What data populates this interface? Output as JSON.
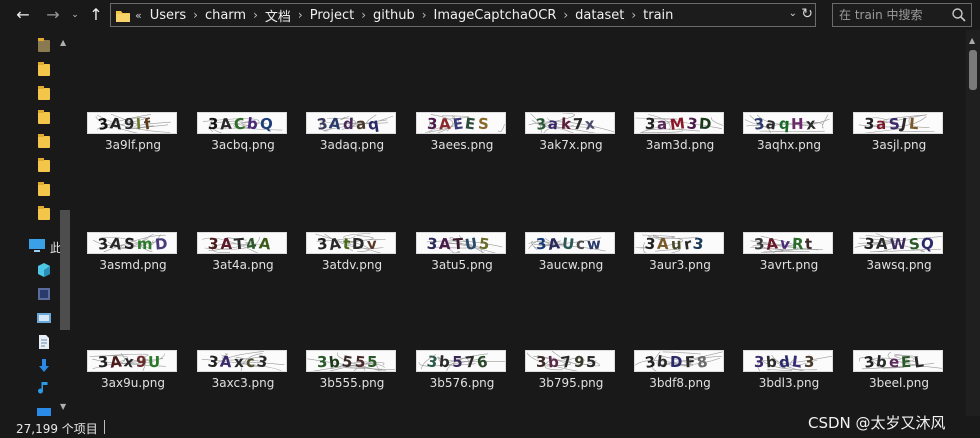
{
  "window": {
    "title": "train"
  },
  "toolbar": {
    "back_icon": "arrow-left-icon",
    "forward_icon": "arrow-right-icon",
    "recent_icon": "chevron-down-icon",
    "up_icon": "arrow-up-icon"
  },
  "address": {
    "lead": "«",
    "crumbs": [
      "Users",
      "charm",
      "文档",
      "Project",
      "github",
      "ImageCaptchaOCR",
      "dataset",
      "train"
    ],
    "separator": "›"
  },
  "search": {
    "placeholder": "在 train 中搜索"
  },
  "nav": {
    "pc_label": "此"
  },
  "files": [
    {
      "name": "3a9lf.png",
      "captcha": [
        "3",
        "A",
        "9",
        "l",
        "f"
      ],
      "colors": [
        "#111111",
        "#222222",
        "#2b2b2b",
        "#6b7a2a",
        "#5a3a1a"
      ]
    },
    {
      "name": "3acbq.png",
      "captcha": [
        "3",
        "A",
        "C",
        "b",
        "Q"
      ],
      "colors": [
        "#111111",
        "#2a2a2a",
        "#2f6b2a",
        "#4a2a7a",
        "#1f3f7a"
      ]
    },
    {
      "name": "3adaq.png",
      "captcha": [
        "3",
        "A",
        "d",
        "a",
        "q"
      ],
      "colors": [
        "#3a3a5a",
        "#2a3a6a",
        "#4a2a5a",
        "#4a3a2a",
        "#2a2a6a"
      ]
    },
    {
      "name": "3aees.png",
      "captcha": [
        "3",
        "A",
        "E",
        "E",
        "S"
      ],
      "colors": [
        "#4a1a4a",
        "#8a2a2a",
        "#3a3a7a",
        "#2a4a3a",
        "#8a6a2a"
      ]
    },
    {
      "name": "3ak7x.png",
      "captcha": [
        "3",
        "a",
        "k",
        "7",
        "x"
      ],
      "colors": [
        "#2a5a3a",
        "#3a2a6a",
        "#5a1a3a",
        "#2a2a2a",
        "#4a4a6a"
      ]
    },
    {
      "name": "3am3d.png",
      "captcha": [
        "3",
        "a",
        "M",
        "3",
        "D"
      ],
      "colors": [
        "#222222",
        "#5a2a5a",
        "#8a1a2a",
        "#4a1a4a",
        "#1a3a1a"
      ]
    },
    {
      "name": "3aqhx.png",
      "captcha": [
        "3",
        "a",
        "q",
        "H",
        "x"
      ],
      "colors": [
        "#2a3a6a",
        "#2a2a2a",
        "#1a6a2a",
        "#6a2a6a",
        "#2a2a2a"
      ]
    },
    {
      "name": "3asjl.png",
      "captcha": [
        "3",
        "a",
        "S",
        "J",
        "L"
      ],
      "colors": [
        "#222222",
        "#7a1a2a",
        "#3a2a6a",
        "#2a2a2a",
        "#7a5a2a"
      ]
    },
    {
      "name": "3asmd.png",
      "captcha": [
        "3",
        "A",
        "S",
        "m",
        "D"
      ],
      "colors": [
        "#222222",
        "#2a2a2a",
        "#222222",
        "#2a7a2a",
        "#4a3a7a"
      ]
    },
    {
      "name": "3at4a.png",
      "captcha": [
        "3",
        "A",
        "T",
        "4",
        "A"
      ],
      "colors": [
        "#4a1a1a",
        "#5a1a2a",
        "#2a2a2a",
        "#2a5a2a",
        "#3a5a1a"
      ]
    },
    {
      "name": "3atdv.png",
      "captcha": [
        "3",
        "A",
        "t",
        "D",
        "v"
      ],
      "colors": [
        "#222222",
        "#2a2a2a",
        "#4a6a1a",
        "#2a2a2a",
        "#5a3a2a"
      ]
    },
    {
      "name": "3atu5.png",
      "captcha": [
        "3",
        "A",
        "T",
        "U",
        "5"
      ],
      "colors": [
        "#2a2a5a",
        "#4a1a4a",
        "#3a1a2a",
        "#2a4a6a",
        "#6a6a2a"
      ]
    },
    {
      "name": "3aucw.png",
      "captcha": [
        "3",
        "A",
        "U",
        "c",
        "w"
      ],
      "colors": [
        "#1a3a7a",
        "#2a2a5a",
        "#2a5a5a",
        "#4a4a4a",
        "#2a3a6a"
      ]
    },
    {
      "name": "3aur3.png",
      "captcha": [
        "3",
        "A",
        "u",
        "r",
        "3"
      ],
      "colors": [
        "#222222",
        "#7a5a2a",
        "#4a4a2a",
        "#2a2a2a",
        "#1a3a5a"
      ]
    },
    {
      "name": "3avrt.png",
      "captcha": [
        "3",
        "A",
        "v",
        "R",
        "t"
      ],
      "colors": [
        "#3a3a3a",
        "#6a1a2a",
        "#4a2a7a",
        "#2a6a2a",
        "#3a2a2a"
      ]
    },
    {
      "name": "3awsq.png",
      "captcha": [
        "3",
        "A",
        "W",
        "S",
        "Q"
      ],
      "colors": [
        "#222222",
        "#2a2a2a",
        "#3a2a5a",
        "#2a5a2a",
        "#2a2a6a"
      ]
    },
    {
      "name": "3ax9u.png",
      "captcha": [
        "3",
        "A",
        "x",
        "9",
        "U"
      ],
      "colors": [
        "#222222",
        "#4a1a1a",
        "#2a2a2a",
        "#6a2a2a",
        "#2a7a2a"
      ]
    },
    {
      "name": "3axc3.png",
      "captcha": [
        "3",
        "A",
        "x",
        "c",
        "3"
      ],
      "colors": [
        "#222222",
        "#3a2a6a",
        "#2a2a2a",
        "#4a4a2a",
        "#2a2a2a"
      ]
    },
    {
      "name": "3b555.png",
      "captcha": [
        "3",
        "b",
        "5",
        "5",
        "5"
      ],
      "colors": [
        "#2a5a2a",
        "#1a3a1a",
        "#3a2a2a",
        "#4a2a2a",
        "#2a5a2a"
      ]
    },
    {
      "name": "3b576.png",
      "captcha": [
        "3",
        "b",
        "5",
        "7",
        "6"
      ],
      "colors": [
        "#2a5a4a",
        "#2a2a2a",
        "#3a2a5a",
        "#2a2a2a",
        "#2a4a2a"
      ]
    },
    {
      "name": "3b795.png",
      "captcha": [
        "3",
        "b",
        "7",
        "9",
        "5"
      ],
      "colors": [
        "#3a2a2a",
        "#5a2a4a",
        "#2a2a2a",
        "#3a3a2a",
        "#2a2a2a"
      ]
    },
    {
      "name": "3bdf8.png",
      "captcha": [
        "3",
        "b",
        "D",
        "F",
        "8"
      ],
      "colors": [
        "#222222",
        "#2a2a2a",
        "#2a2a6a",
        "#2a2a2a",
        "#6a6a6a"
      ]
    },
    {
      "name": "3bdl3.png",
      "captcha": [
        "3",
        "b",
        "d",
        "L",
        "3"
      ],
      "colors": [
        "#3a2a6a",
        "#2a2a2a",
        "#2a2a6a",
        "#3a2a7a",
        "#4a3a2a"
      ]
    },
    {
      "name": "3beel.png",
      "captcha": [
        "3",
        "b",
        "e",
        "E",
        "L"
      ],
      "colors": [
        "#222222",
        "#2a2a2a",
        "#5a2a5a",
        "#2a5a2a",
        "#2a2a2a"
      ]
    }
  ],
  "status": {
    "item_count": "27,199 个项目"
  },
  "watermark": "CSDN @太岁又沐风",
  "accent": {
    "folder": "#f3c64b"
  }
}
